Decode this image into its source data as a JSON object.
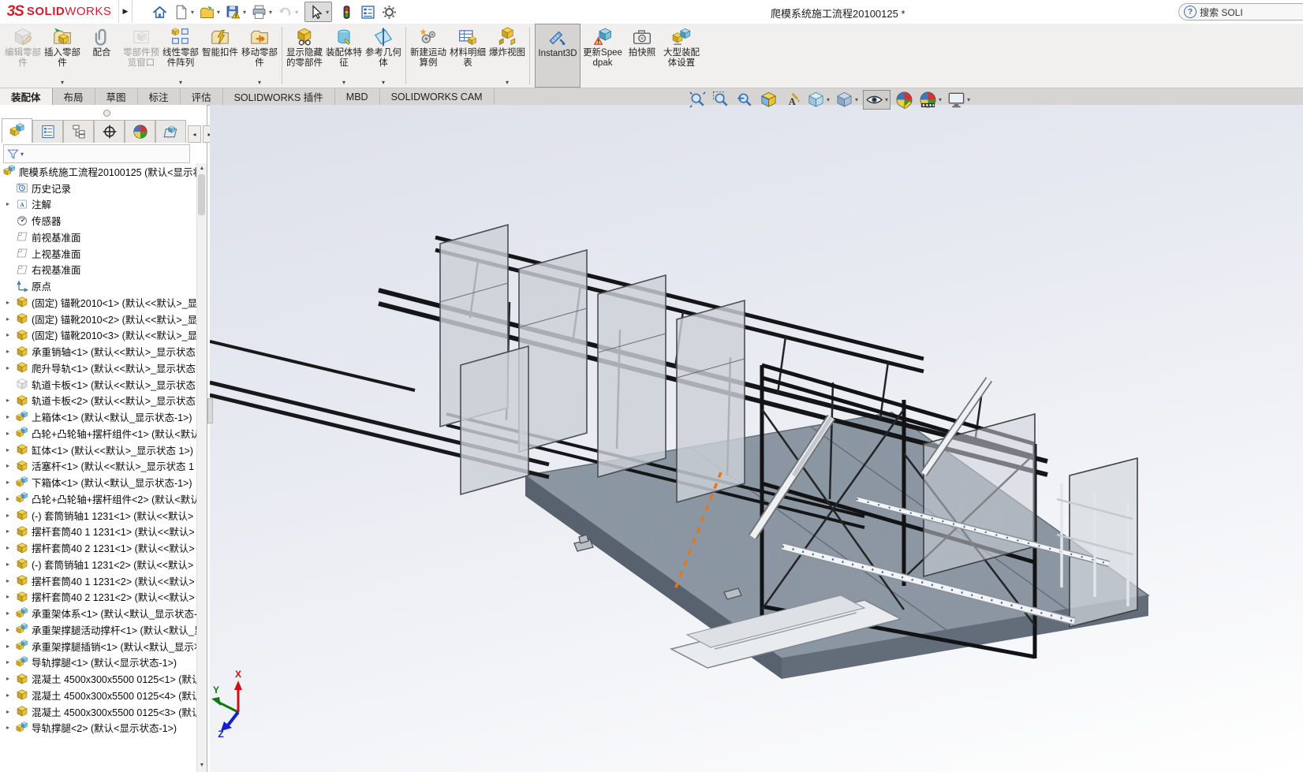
{
  "window": {
    "logo_mark": "3S",
    "logo_solid": "SOLID",
    "logo_works": "WORKS",
    "document_title": "爬模系统施工流程20100125 *",
    "search_label": "搜索 SOLI"
  },
  "quick_access": [
    {
      "name": "home-icon"
    },
    {
      "name": "new-document-icon",
      "dropdown": true
    },
    {
      "name": "open-icon",
      "dropdown": true
    },
    {
      "name": "save-icon",
      "dropdown": true
    },
    {
      "name": "print-icon",
      "dropdown": true
    },
    {
      "name": "undo-icon",
      "dropdown": true,
      "disabled": true
    },
    {
      "name": "select-cursor-icon",
      "dropdown": true,
      "boxed": true
    },
    {
      "name": "rebuild-traffic-light-icon"
    },
    {
      "name": "display-pane-icon"
    },
    {
      "name": "options-gear-icon"
    }
  ],
  "ribbon": {
    "buttons": [
      {
        "label": "编辑零部件",
        "icon": "edit-component",
        "disabled": true
      },
      {
        "label": "插入零部件",
        "icon": "insert-component",
        "dropdown": true
      },
      {
        "label": "配合",
        "icon": "mate"
      },
      {
        "label": "零部件预览窗口",
        "icon": "component-preview",
        "disabled": true
      },
      {
        "label": "线性零部件阵列",
        "icon": "linear-pattern",
        "dropdown": true
      },
      {
        "label": "智能扣件",
        "icon": "smart-fastener"
      },
      {
        "label": "移动零部件",
        "icon": "move-component",
        "dropdown": true
      },
      {
        "sep": true
      },
      {
        "label": "显示隐藏的零部件",
        "icon": "show-hidden"
      },
      {
        "label": "装配体特征",
        "icon": "assembly-feature",
        "dropdown": true
      },
      {
        "label": "参考几何体",
        "icon": "reference-geometry",
        "dropdown": true
      },
      {
        "sep": true
      },
      {
        "label": "新建运动算例",
        "icon": "motion-study"
      },
      {
        "label": "材料明细表",
        "icon": "bom-table"
      },
      {
        "label": "爆炸视图",
        "icon": "exploded-view",
        "dropdown": true
      },
      {
        "sep": true
      },
      {
        "label": "Instant3D",
        "icon": "instant3d",
        "active": true
      },
      {
        "label": "更新Speedpak",
        "icon": "update-speedpak"
      },
      {
        "label": "拍快照",
        "icon": "snapshot"
      },
      {
        "label": "大型装配体设置",
        "icon": "large-assembly"
      }
    ]
  },
  "command_tabs": {
    "active": 0,
    "items": [
      "装配体",
      "布局",
      "草图",
      "标注",
      "评估",
      "SOLIDWORKS 插件",
      "MBD",
      "SOLIDWORKS CAM"
    ]
  },
  "headsup": [
    {
      "name": "zoom-fit-icon"
    },
    {
      "name": "zoom-area-icon"
    },
    {
      "name": "previous-view-icon"
    },
    {
      "name": "section-view-icon"
    },
    {
      "name": "annotation-visibility-icon"
    },
    {
      "name": "view-orientation-icon",
      "dropdown": true
    },
    {
      "name": "display-style-icon",
      "dropdown": true
    },
    {
      "name": "hide-show-items-icon",
      "dropdown": true,
      "boxed": true
    },
    {
      "name": "edit-appearance-icon"
    },
    {
      "name": "apply-scene-icon",
      "dropdown": true
    },
    {
      "name": "view-settings-icon",
      "dropdown": true
    }
  ],
  "panel": {
    "tabs": [
      {
        "name": "featuremanager-tab",
        "icon": "featuremanager-icon",
        "active": true
      },
      {
        "name": "propertymanager-tab",
        "icon": "propertymanager-icon"
      },
      {
        "name": "configurationmanager-tab",
        "icon": "configurationmanager-icon"
      },
      {
        "name": "dimxpertmanager-tab",
        "icon": "dimxpert-icon"
      },
      {
        "name": "displaymanager-tab",
        "icon": "displaymanager-icon"
      },
      {
        "name": "cam-manager-tab",
        "icon": "cam-tab-icon"
      }
    ],
    "scroll_left": "◂",
    "scroll_right": "▸",
    "tree": [
      {
        "icon": "t-root",
        "root": true,
        "label": "爬模系统施工流程20100125  (默认<显示状"
      },
      {
        "icon": "t-history",
        "label": "历史记录"
      },
      {
        "icon": "t-ann",
        "arrow": true,
        "label": "注解"
      },
      {
        "icon": "t-sensor",
        "label": "传感器"
      },
      {
        "icon": "t-plane",
        "label": "前视基准面"
      },
      {
        "icon": "t-plane",
        "label": "上视基准面"
      },
      {
        "icon": "t-plane",
        "label": "右视基准面"
      },
      {
        "icon": "t-origin",
        "label": "原点"
      },
      {
        "icon": "t-part",
        "arrow": true,
        "label": "(固定) 锚靴2010<1> (默认<<默认>_显"
      },
      {
        "icon": "t-part",
        "arrow": true,
        "label": "(固定) 锚靴2010<2> (默认<<默认>_显"
      },
      {
        "icon": "t-part",
        "arrow": true,
        "label": "(固定) 锚靴2010<3> (默认<<默认>_显"
      },
      {
        "icon": "t-part",
        "arrow": true,
        "label": "承重销轴<1> (默认<<默认>_显示状态"
      },
      {
        "icon": "t-part",
        "arrow": true,
        "label": "爬升导轨<1> (默认<<默认>_显示状态"
      },
      {
        "icon": "t-part-hidden",
        "label": "轨道卡板<1> (默认<<默认>_显示状态"
      },
      {
        "icon": "t-part",
        "arrow": true,
        "label": "轨道卡板<2> (默认<<默认>_显示状态"
      },
      {
        "icon": "t-asm",
        "arrow": true,
        "label": "上箱体<1> (默认<默认_显示状态-1>)"
      },
      {
        "icon": "t-asm",
        "arrow": true,
        "label": "凸轮+凸轮轴+摆杆组件<1> (默认<默认"
      },
      {
        "icon": "t-part",
        "arrow": true,
        "label": "缸体<1> (默认<<默认>_显示状态 1>)"
      },
      {
        "icon": "t-part",
        "arrow": true,
        "label": "活塞杆<1> (默认<<默认>_显示状态 1"
      },
      {
        "icon": "t-asm",
        "arrow": true,
        "label": "下箱体<1> (默认<默认_显示状态-1>)"
      },
      {
        "icon": "t-asm",
        "arrow": true,
        "label": "凸轮+凸轮轴+摆杆组件<2> (默认<默认"
      },
      {
        "icon": "t-part",
        "arrow": true,
        "label": "(-) 套筒销轴1 1231<1> (默认<<默认>"
      },
      {
        "icon": "t-part",
        "arrow": true,
        "label": "摆杆套筒40 1 1231<1> (默认<<默认>"
      },
      {
        "icon": "t-part",
        "arrow": true,
        "label": "摆杆套筒40 2 1231<1> (默认<<默认>"
      },
      {
        "icon": "t-part",
        "arrow": true,
        "label": "(-) 套筒销轴1 1231<2> (默认<<默认>"
      },
      {
        "icon": "t-part",
        "arrow": true,
        "label": "摆杆套筒40 1 1231<2> (默认<<默认>"
      },
      {
        "icon": "t-part",
        "arrow": true,
        "label": "摆杆套筒40 2 1231<2> (默认<<默认>"
      },
      {
        "icon": "t-asm",
        "arrow": true,
        "label": "承重架体系<1> (默认<默认_显示状态-1"
      },
      {
        "icon": "t-asm",
        "arrow": true,
        "label": "承重架撑腿活动撑杆<1> (默认<默认_显"
      },
      {
        "icon": "t-asm",
        "arrow": true,
        "label": "承重架撑腿插销<1> (默认<默认_显示状"
      },
      {
        "icon": "t-asm",
        "arrow": true,
        "label": "导轨撑腿<1> (默认<显示状态-1>)"
      },
      {
        "icon": "t-part",
        "arrow": true,
        "label": "混凝土 4500x300x5500 0125<1> (默认"
      },
      {
        "icon": "t-part",
        "arrow": true,
        "label": "混凝土 4500x300x5500 0125<4> (默认"
      },
      {
        "icon": "t-part",
        "arrow": true,
        "label": "混凝土 4500x300x5500 0125<3> (默认"
      },
      {
        "icon": "t-asm",
        "arrow": true,
        "label": "导轨撑腿<2> (默认<显示状态-1>)"
      }
    ]
  },
  "viewport": {
    "triad": {
      "x": "X",
      "y": "Y",
      "z": "Z",
      "x_color": "#cc1111",
      "y_color": "#117711",
      "z_color": "#1122cc"
    }
  }
}
